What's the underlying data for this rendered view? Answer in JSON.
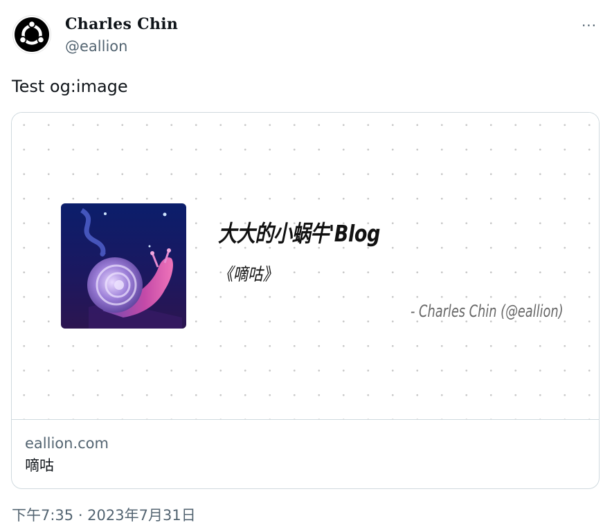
{
  "author": {
    "display_name": "Charles Chin",
    "handle": "@eallion",
    "avatar_icon": "ubuntu-logo-icon"
  },
  "more_icon": "more-horizontal-icon",
  "more_label": "···",
  "tweet": {
    "text": "Test og:image"
  },
  "card": {
    "image": {
      "thumbnail": "snail-artwork",
      "title": "大大的小蜗牛'Blog",
      "subtitle": "《嘀咕》",
      "author": "- Charles Chin (@eallion)"
    },
    "domain": "eallion.com",
    "description": "嘀咕"
  },
  "timestamp": "下午7:35 · 2023年7月31日",
  "colors": {
    "text_primary": "#0f1419",
    "text_secondary": "#536471",
    "border": "#cfd9de"
  }
}
